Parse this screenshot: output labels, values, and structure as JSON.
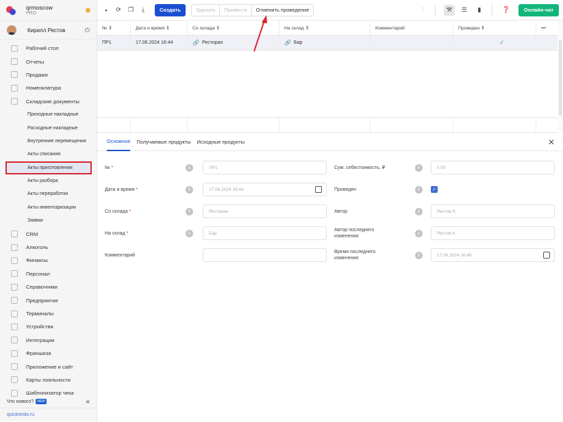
{
  "brand": {
    "name": "qrmoscow",
    "plan": "PRO"
  },
  "user": {
    "name": "Кирилл Рестов"
  },
  "sidebar": {
    "items": [
      {
        "label": "Рабочий стол",
        "icon": "dashboard-icon"
      },
      {
        "label": "Отчеты",
        "icon": "reports-icon"
      },
      {
        "label": "Продажи",
        "icon": "sales-icon"
      },
      {
        "label": "Номенклатура",
        "icon": "tag-icon"
      },
      {
        "label": "Складские документы",
        "icon": "box-icon"
      }
    ],
    "subitems": [
      "Приходные накладные",
      "Расходные накладные",
      "Внутренние перемещения",
      "Акты списания",
      "Акты приготовления",
      "Акты разбора",
      "Акты переработки",
      "Акты инвентаризации",
      "Заявки"
    ],
    "items2": [
      {
        "label": "CRM",
        "icon": "crm-icon"
      },
      {
        "label": "Алкоголь",
        "icon": "glass-icon"
      },
      {
        "label": "Финансы",
        "icon": "wallet-icon"
      },
      {
        "label": "Персонал",
        "icon": "people-icon"
      },
      {
        "label": "Справочники",
        "icon": "book-icon"
      },
      {
        "label": "Предприятие",
        "icon": "building-icon"
      },
      {
        "label": "Терминалы",
        "icon": "terminal-icon"
      },
      {
        "label": "Устройства",
        "icon": "device-icon"
      },
      {
        "label": "Интеграции",
        "icon": "link-icon"
      },
      {
        "label": "Франшиза",
        "icon": "franchise-icon"
      },
      {
        "label": "Приложение и сайт",
        "icon": "app-icon"
      },
      {
        "label": "Карты лояльности",
        "icon": "card-icon"
      },
      {
        "label": "Шаблонизатор чека",
        "icon": "receipt-icon"
      }
    ],
    "whats_new": "Что нового?",
    "new_badge": "NEW",
    "site": "quickresto.ru"
  },
  "toolbar": {
    "create": "Создать",
    "delete": "Удалить",
    "post": "Провести",
    "unpost": "Отменить проведение",
    "chat": "Онлайн-чат"
  },
  "grid": {
    "columns": [
      "№",
      "Дата и время",
      "Со склада",
      "На склад",
      "Комментарий",
      "Проведен"
    ],
    "rows": [
      {
        "num": "ПР1",
        "datetime": "17.06.2024 16:44",
        "from": "Ресторан",
        "to": "Бар",
        "comment": "",
        "posted": true
      }
    ]
  },
  "tabs": [
    "Основное",
    "Получаемые продукты",
    "Исходные продукты"
  ],
  "form": {
    "num_label": "№",
    "num_val": "ПР1",
    "date_label": "Дата и время",
    "date_val": "17.06.2024 16:44",
    "from_label": "Со склада",
    "from_val": "Ресторан",
    "to_label": "На склад",
    "to_val": "Бар",
    "comment_label": "Комментарий",
    "comment_val": "",
    "cost_label": "Сум. себестоимость, ₽",
    "cost_val": "0.00",
    "posted_label": "Проведен",
    "author_label": "Автор",
    "author_val": "Рестов К.",
    "lastauthor_label": "Автор последнего изменения",
    "lastauthor_val": "Рестов К.",
    "lasttime_label": "Время последнего изменения",
    "lasttime_val": "17.06.2024 16:46"
  },
  "colors": {
    "accent": "#1a4fd0",
    "chat": "#12b57a",
    "highlight": "#d8262f"
  }
}
